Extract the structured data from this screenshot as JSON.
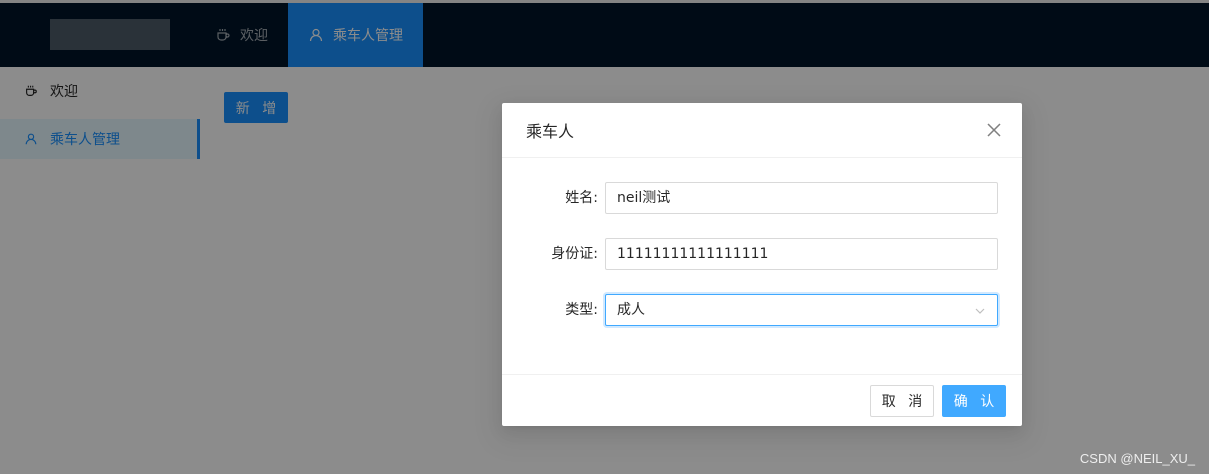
{
  "header": {
    "menu": [
      {
        "label": "欢迎",
        "icon": "coffee-icon"
      },
      {
        "label": "乘车人管理",
        "icon": "user-icon",
        "active": true
      }
    ]
  },
  "sidebar": {
    "items": [
      {
        "label": "欢迎",
        "icon": "coffee-icon"
      },
      {
        "label": "乘车人管理",
        "icon": "user-icon",
        "active": true
      }
    ]
  },
  "content": {
    "add_button": "新 增"
  },
  "modal": {
    "title": "乘车人",
    "close_icon": "close-icon",
    "fields": {
      "name": {
        "label": "姓名:",
        "value": "neil测试"
      },
      "id_card": {
        "label": "身份证:",
        "value": "11111111111111111"
      },
      "type": {
        "label": "类型:",
        "value": "成人"
      }
    },
    "cancel_label": "取 消",
    "ok_label": "确 认"
  },
  "watermark": "CSDN @NEIL_XU_",
  "colors": {
    "header_bg": "#001529",
    "primary": "#1890ff",
    "ok_button": "#40a9ff"
  }
}
